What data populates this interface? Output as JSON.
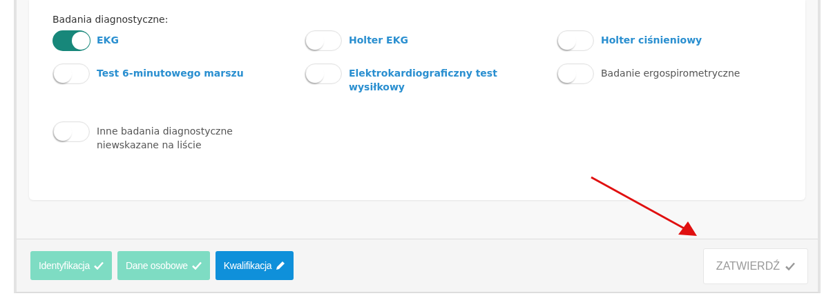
{
  "section": {
    "title": "Badania diagnostyczne:",
    "items": [
      {
        "label": "EKG",
        "kind": "link",
        "on": true
      },
      {
        "label": "Holter EKG",
        "kind": "link",
        "on": false
      },
      {
        "label": "Holter ciśnieniowy",
        "kind": "link",
        "on": false
      },
      {
        "label": "Test 6-minutowego marszu",
        "kind": "link",
        "on": false
      },
      {
        "label": "Elektrokardiograficzny test wysiłkowy",
        "kind": "link",
        "on": false
      },
      {
        "label": "Badanie ergospirometryczne",
        "kind": "text",
        "on": false
      },
      {
        "label": "Inne badania diagnostyczne niewskazane na liście",
        "kind": "text",
        "on": false
      }
    ]
  },
  "steps": [
    {
      "label": "Identyfikacja",
      "completed": true,
      "selected": false
    },
    {
      "label": "Dane osobowe",
      "completed": true,
      "selected": false
    },
    {
      "label": "Kwalifikacja",
      "completed": false,
      "selected": true
    }
  ],
  "submit": {
    "label": "ZATWIERDŹ",
    "disabled": true
  }
}
